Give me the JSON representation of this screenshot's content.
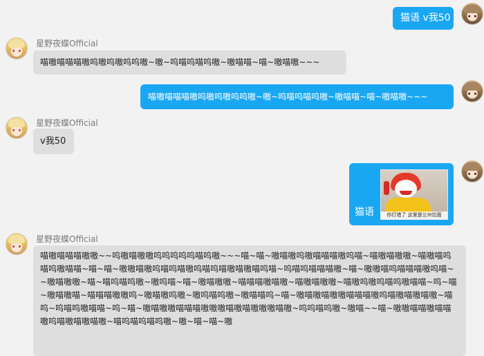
{
  "contact": {
    "name": "星野夜蝶Official"
  },
  "messages": {
    "m1": "猫语 v我50",
    "m2": "喵嗷喵喵喵嗷呜嗷呜嗷呜呜嗷~嗷~呜喵呜喵呜嗷~嗷喵喵~喵~嗷喵嗷~~~",
    "m3": "喵嗷喵喵喵嗷呜嗷呜嗷呜呜嗷~嗷~呜喵呜喵呜嗷~嗷喵喵~喵~嗷喵嗷~~~",
    "m4": "v我50",
    "m5_label": "猫语",
    "m5_caption": "你打错了  这里是兰州拉面",
    "m6": "喵嗷喵喵喵嗷嗷~~呜嗷喵嗷嗷呜呜呜呜呜喵呜嗷~~~喵~喵~嗷喵嗷呜嗷喵喵喵嗷呜喵~喵嗷喵嗷嗷~喵嗷喵呜喵呜嗷喵喵~喵~喵~嗷嗷喵嗷呜喵呜喵嗷呜喵呜喵嗷喵嗷喵呜喵~呜喵呜喵喵喵嗷~喵~嗷嗷喵呜喵喵喵嗷呜喵~~嗷喵嗷嗷~喵~喵呜喵呜嗷~嗷呜喵~喵~嗷喵嗷嗷~喵喵喵嗷喵嗷~喵嗷喵嗷嗷~喵嗷呜嗷呜喵呜嗷喵喵~呜~喵~嗷喵嗷喵~喵喵喵嗷嗷呜~嗷喵嗷呜嗷~嗷呜喵呜嗷~嗷喵喵呜~喵~嗷喵嗷喵嗷嗷喵喵喵嗷呜喵嗷喵嗷喵嗷~喵呜~呜喵呜嗷喵喵~呜~喵~嗷喵嗷嗷喵喵喵嗷嗷嗷喵嗷喵嗷嗷嗷喵嗷~呜呜喵呜嗷~嗷喵~~喵~嗷嗷喵喵嗷喵喵嗷呜喵嗷喵嗷喵嗷~喵呜喵呜喵呜嗷~嗷~喵~喵~嗷"
  }
}
